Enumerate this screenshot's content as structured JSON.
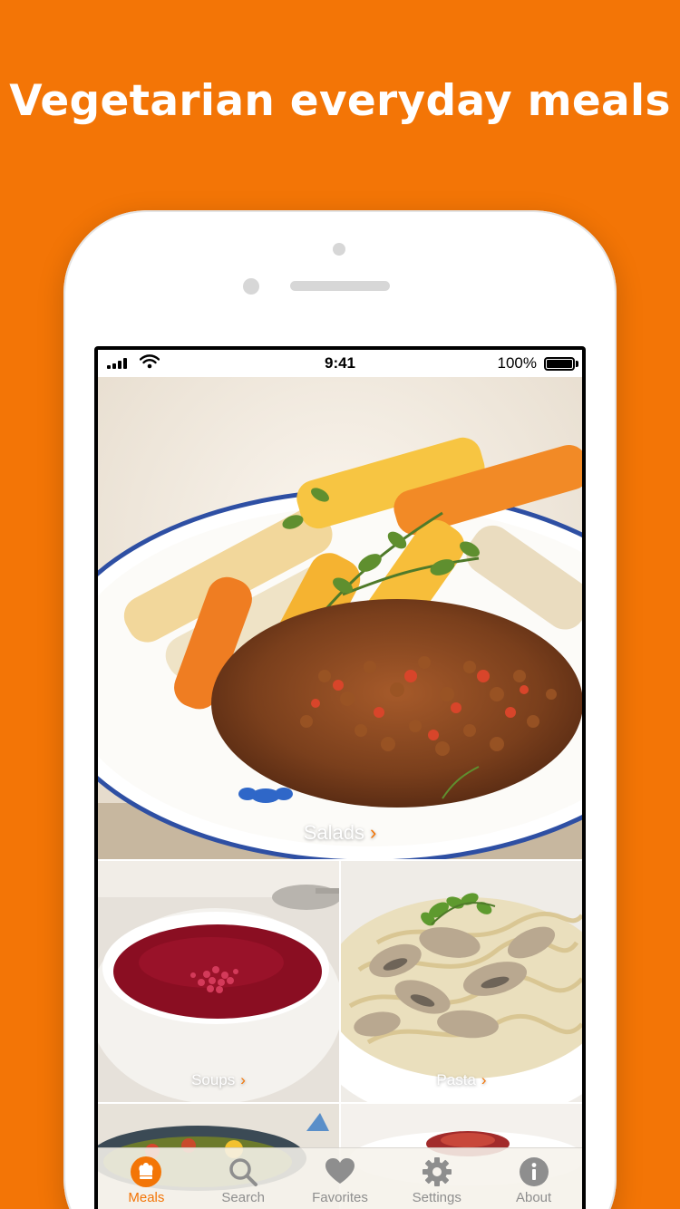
{
  "headline": "Vegetarian everyday meals",
  "status_bar": {
    "time": "9:41",
    "battery": "100%"
  },
  "categories": {
    "hero": {
      "label": "Salads",
      "chevron": "›"
    },
    "left": {
      "label": "Soups",
      "chevron": "›"
    },
    "right": {
      "label": "Pasta",
      "chevron": "›"
    }
  },
  "tabs": [
    {
      "label": "Meals",
      "icon": "chef-hat-icon",
      "active": true
    },
    {
      "label": "Search",
      "icon": "search-icon",
      "active": false
    },
    {
      "label": "Favorites",
      "icon": "heart-icon",
      "active": false
    },
    {
      "label": "Settings",
      "icon": "gear-icon",
      "active": false
    },
    {
      "label": "About",
      "icon": "info-icon",
      "active": false
    }
  ],
  "colors": {
    "accent": "#F37506",
    "inactive_tab": "#8E8E8E"
  }
}
